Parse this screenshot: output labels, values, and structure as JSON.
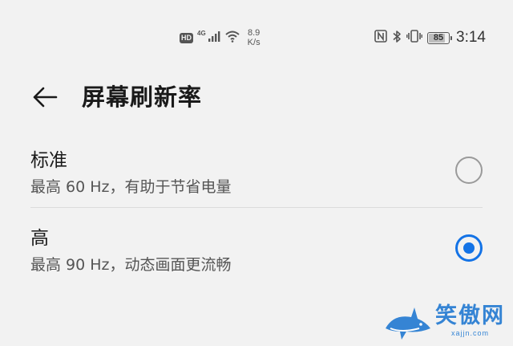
{
  "status_bar": {
    "hd_badge": "HD",
    "network_gen": "4G",
    "speed_value": "8.9",
    "speed_unit": "K/s",
    "battery_level": "85",
    "time": "3:14"
  },
  "header": {
    "back_icon": "arrow-left-icon",
    "title": "屏幕刷新率"
  },
  "options": [
    {
      "title": "标准",
      "subtitle": "最高 60 Hz，有助于节省电量",
      "selected": false
    },
    {
      "title": "高",
      "subtitle": "最高 90 Hz，动态画面更流畅",
      "selected": true
    }
  ],
  "watermark": {
    "name": "笑傲网",
    "domain": "xajjn.com"
  },
  "colors": {
    "accent": "#1473e6",
    "background": "#f2f2f2",
    "watermark": "#2b7fd3"
  }
}
